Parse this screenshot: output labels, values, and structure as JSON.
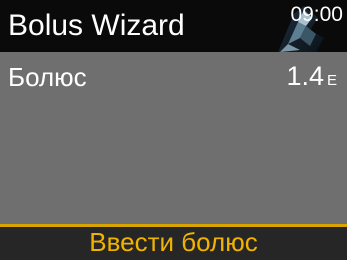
{
  "header": {
    "title": "Bolus Wizard",
    "time": "09:00",
    "status_icon": "bolus-status-icon"
  },
  "main": {
    "row_label": "Болюс",
    "row_value": "1.4",
    "row_unit": "Е"
  },
  "footer": {
    "action_label": "Ввести болюс"
  },
  "colors": {
    "header_bg": "#0a0a0a",
    "content_bg": "#6f6f6f",
    "footer_bg": "#262626",
    "accent": "#d7a400",
    "action_text": "#f2b300"
  }
}
